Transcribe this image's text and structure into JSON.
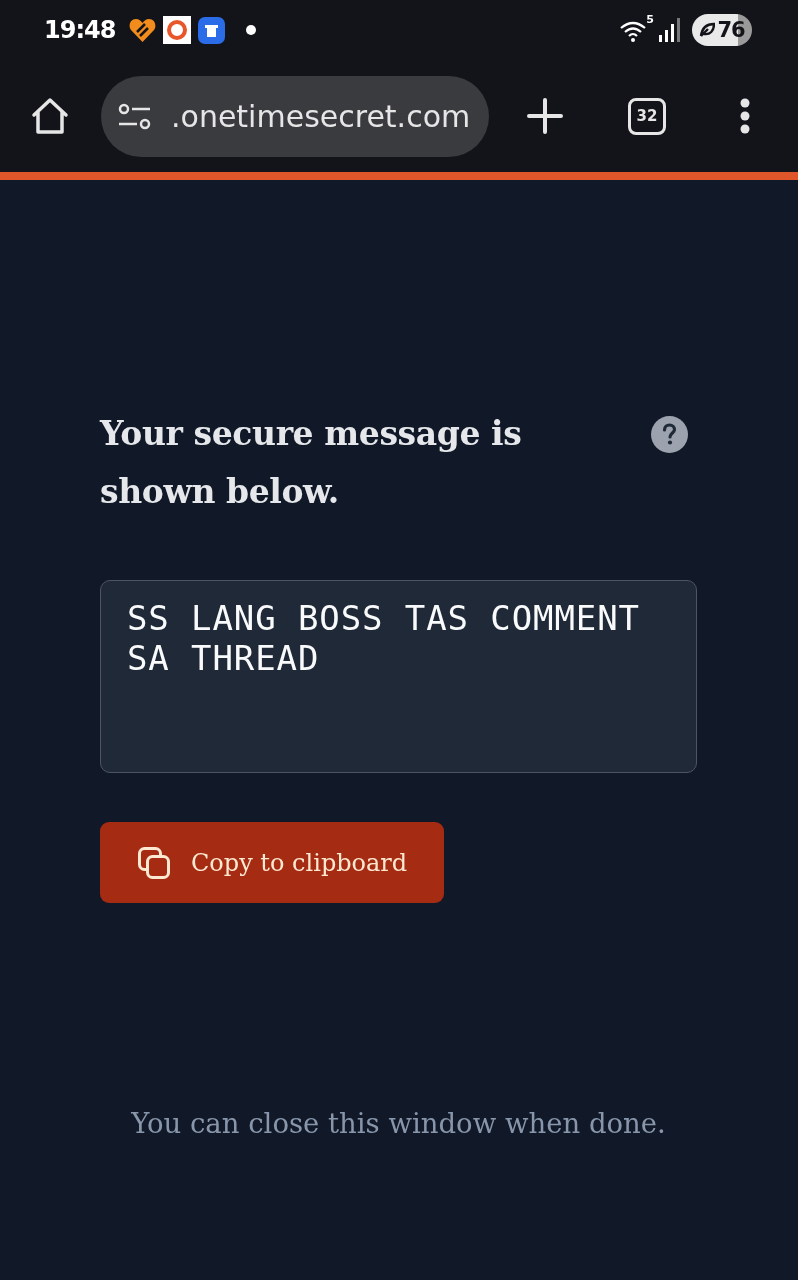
{
  "status_bar": {
    "time": "19:48",
    "network_label": "5",
    "battery": "76"
  },
  "browser": {
    "url": ".onetimesecret.com",
    "tab_count": "32"
  },
  "page": {
    "heading": "Your secure message is shown below.",
    "message": "SS LANG BOSS TAS COMMENT SA THREAD",
    "copy_button": "Copy to clipboard",
    "footer": "You can close this window when done."
  }
}
